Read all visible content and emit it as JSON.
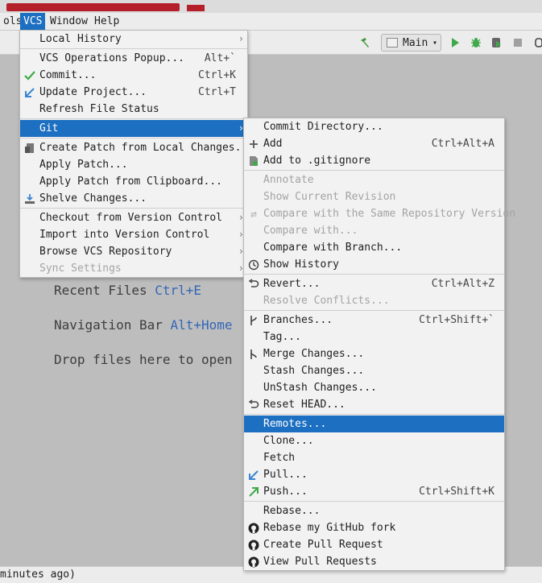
{
  "menubar": {
    "items": [
      {
        "label": "ols"
      },
      {
        "label": "VCS"
      },
      {
        "label": "Window"
      },
      {
        "label": "Help"
      }
    ]
  },
  "toolbar": {
    "run_config": "Main"
  },
  "editor": {
    "hints": [
      {
        "text": "Recent Files",
        "shortcut": "Ctrl+E"
      },
      {
        "text": "Navigation Bar",
        "shortcut": "Alt+Home"
      },
      {
        "text": "Drop files here to open",
        "shortcut": ""
      }
    ]
  },
  "status": {
    "text": "minutes ago)"
  },
  "vcs_menu": {
    "items": [
      {
        "label": "Local History",
        "shortcut": "",
        "submenu": true
      },
      {
        "label": "VCS Operations Popup...",
        "shortcut": "Alt+`"
      },
      {
        "label": "Commit...",
        "shortcut": "Ctrl+K",
        "icon": "check-icon"
      },
      {
        "label": "Update Project...",
        "shortcut": "Ctrl+T",
        "icon": "update-arrow-icon"
      },
      {
        "label": "Refresh File Status",
        "shortcut": ""
      },
      {
        "label": "Git",
        "shortcut": "",
        "submenu": true,
        "selected": true
      },
      {
        "label": "Create Patch from Local Changes...",
        "shortcut": "",
        "icon": "patch-icon"
      },
      {
        "label": "Apply Patch...",
        "shortcut": ""
      },
      {
        "label": "Apply Patch from Clipboard...",
        "shortcut": ""
      },
      {
        "label": "Shelve Changes...",
        "shortcut": "",
        "icon": "shelve-icon"
      },
      {
        "label": "Checkout from Version Control",
        "shortcut": "",
        "submenu": true
      },
      {
        "label": "Import into Version Control",
        "shortcut": "",
        "submenu": true
      },
      {
        "label": "Browse VCS Repository",
        "shortcut": "",
        "submenu": true
      },
      {
        "label": "Sync Settings",
        "shortcut": "",
        "submenu": true,
        "disabled": true
      }
    ]
  },
  "git_menu": {
    "items": [
      {
        "label": "Commit Directory...",
        "shortcut": ""
      },
      {
        "label": "Add",
        "shortcut": "Ctrl+Alt+A",
        "icon": "plus-icon"
      },
      {
        "label": "Add to .gitignore",
        "shortcut": "",
        "icon": "gitignore-file-icon"
      },
      {
        "label": "Annotate",
        "shortcut": "",
        "disabled": true
      },
      {
        "label": "Show Current Revision",
        "shortcut": "",
        "disabled": true
      },
      {
        "label": "Compare with the Same Repository Version",
        "shortcut": "",
        "disabled": true,
        "icon": "compare-arrows-icon"
      },
      {
        "label": "Compare with...",
        "shortcut": "",
        "disabled": true
      },
      {
        "label": "Compare with Branch...",
        "shortcut": ""
      },
      {
        "label": "Show History",
        "shortcut": "",
        "icon": "clock-icon"
      },
      {
        "label": "Revert...",
        "shortcut": "Ctrl+Alt+Z",
        "icon": "revert-icon"
      },
      {
        "label": "Resolve Conflicts...",
        "shortcut": "",
        "disabled": true
      },
      {
        "label": "Branches...",
        "shortcut": "Ctrl+Shift+`",
        "icon": "branch-icon"
      },
      {
        "label": "Tag...",
        "shortcut": ""
      },
      {
        "label": "Merge Changes...",
        "shortcut": "",
        "icon": "merge-icon"
      },
      {
        "label": "Stash Changes...",
        "shortcut": ""
      },
      {
        "label": "UnStash Changes...",
        "shortcut": ""
      },
      {
        "label": "Reset HEAD...",
        "shortcut": "",
        "icon": "reset-icon"
      },
      {
        "label": "Remotes...",
        "shortcut": "",
        "selected": true
      },
      {
        "label": "Clone...",
        "shortcut": ""
      },
      {
        "label": "Fetch",
        "shortcut": ""
      },
      {
        "label": "Pull...",
        "shortcut": "",
        "icon": "pull-arrow-icon"
      },
      {
        "label": "Push...",
        "shortcut": "Ctrl+Shift+K",
        "icon": "push-arrow-icon"
      },
      {
        "label": "Rebase...",
        "shortcut": ""
      },
      {
        "label": "Rebase my GitHub fork",
        "shortcut": "",
        "icon": "github-icon"
      },
      {
        "label": "Create Pull Request",
        "shortcut": "",
        "icon": "github-icon"
      },
      {
        "label": "View Pull Requests",
        "shortcut": "",
        "icon": "github-icon"
      }
    ]
  }
}
